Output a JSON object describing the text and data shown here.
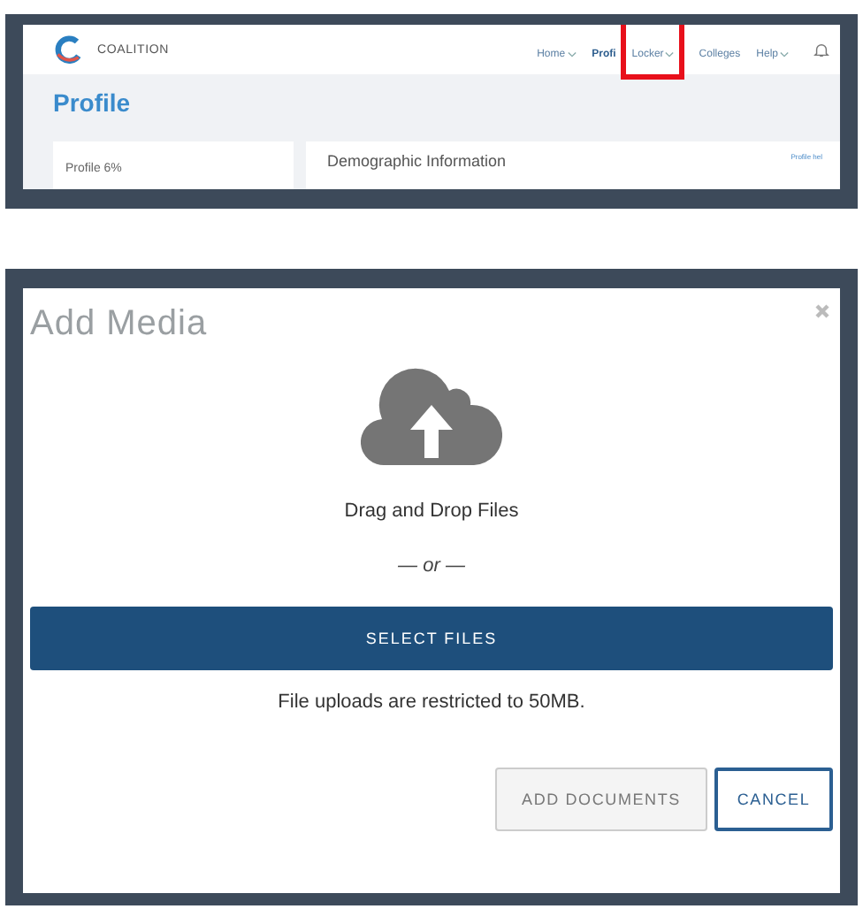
{
  "top_screenshot": {
    "brand": "COALITION",
    "nav": [
      {
        "label": "Home",
        "dropdown": true,
        "highlighted": false
      },
      {
        "label": "Profi",
        "dropdown": false,
        "highlighted": false
      },
      {
        "label": "Locker",
        "dropdown": true,
        "highlighted": true
      },
      {
        "label": "Colleges",
        "dropdown": false,
        "highlighted": false
      },
      {
        "label": "Help",
        "dropdown": true,
        "highlighted": false
      }
    ],
    "page_title": "Profile",
    "sidebar_item": "Profile 6%",
    "section_heading": "Demographic Information",
    "help_link": "Profile hel"
  },
  "dialog": {
    "title": "Add Media",
    "drop_label": "Drag and Drop Files",
    "separator": "— or —",
    "select_button": "SELECT FILES",
    "note": "File uploads are restricted to 50MB.",
    "buttons": [
      {
        "label": "ADD DOCUMENTS",
        "kind": "secondary",
        "disabled": true
      },
      {
        "label": "CANCEL",
        "kind": "outline",
        "disabled": false
      }
    ]
  }
}
